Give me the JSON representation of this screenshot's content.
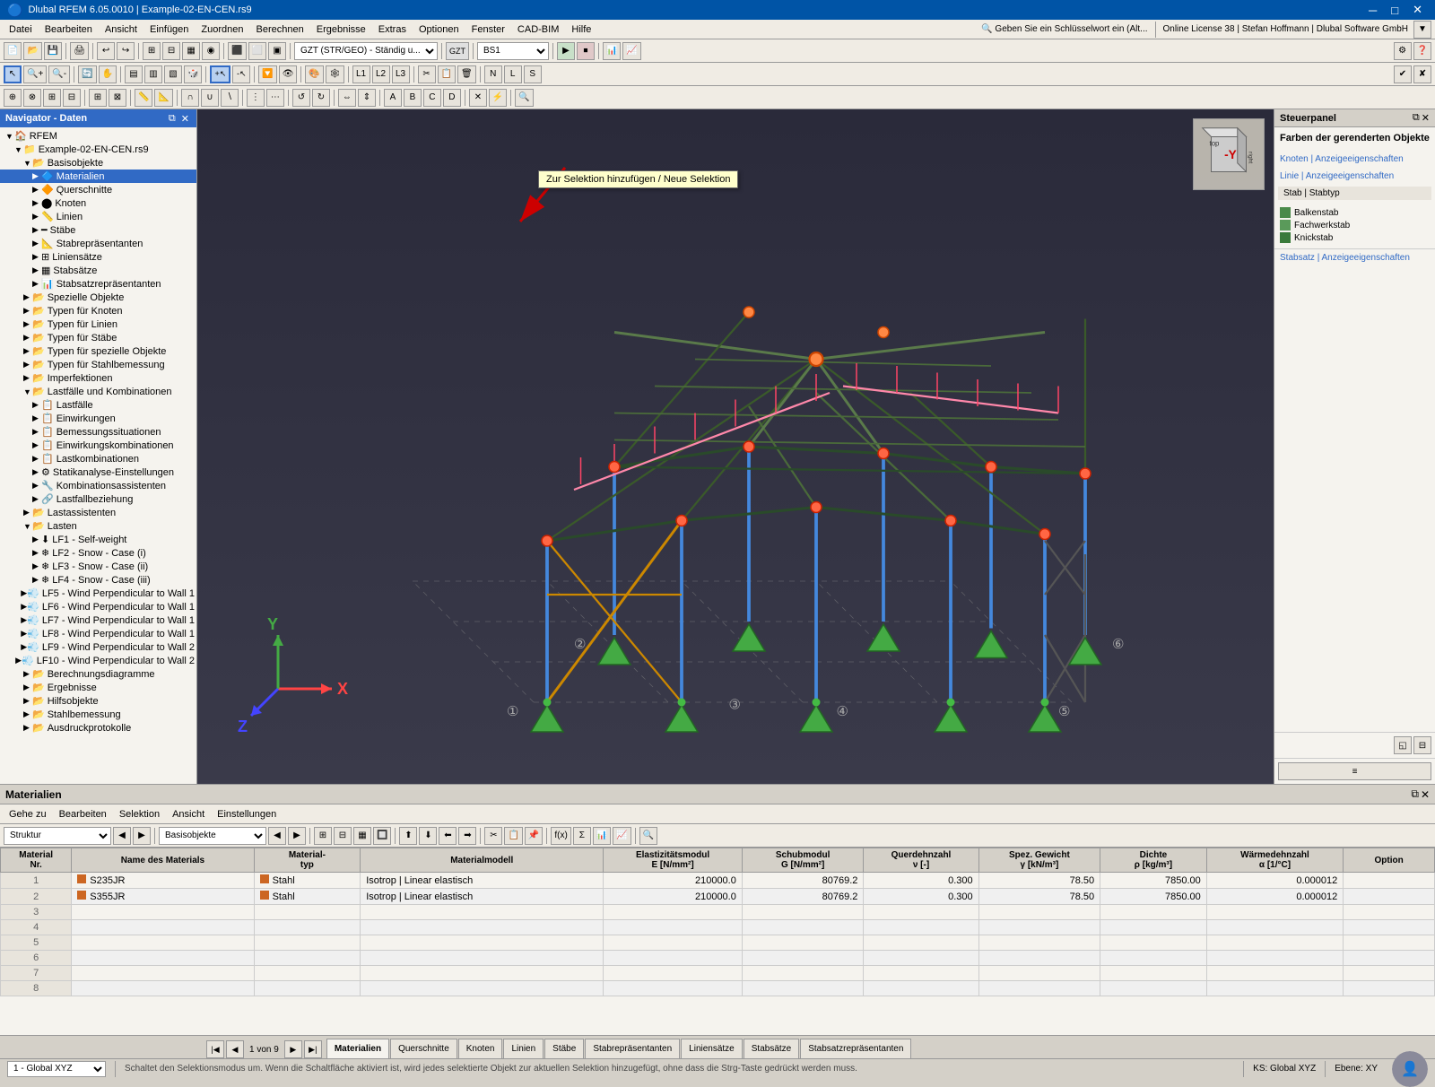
{
  "titleBar": {
    "title": "Dlubal RFEM 6.05.0010 | Example-02-EN-CEN.rs9",
    "minimizeLabel": "─",
    "maximizeLabel": "□",
    "closeLabel": "✕"
  },
  "menuBar": {
    "items": [
      "Datei",
      "Bearbeiten",
      "Ansicht",
      "Einfügen",
      "Zuordnen",
      "Berechnen",
      "Ergebnisse",
      "Extras",
      "Optionen",
      "Fenster",
      "CAD-BIM",
      "Hilfe"
    ]
  },
  "toolbar1": {
    "comboBox1": "GZT (STR/GEO) - Ständig u...",
    "comboBox2": "BS1",
    "onlineLabel": "Online License 38 | Stefan Hoffmann | Dlubal Software GmbH"
  },
  "tooltip": {
    "text": "Zur Selektion hinzufügen / Neue Selektion"
  },
  "navigator": {
    "title": "Navigator - Daten",
    "rootItem": "RFEM",
    "projectItem": "Example-02-EN-CEN.rs9",
    "tree": [
      {
        "label": "Basisobjekte",
        "level": 2,
        "expanded": true,
        "hasChildren": true
      },
      {
        "label": "Materialien",
        "level": 3,
        "expanded": false,
        "hasChildren": true
      },
      {
        "label": "Querschnitte",
        "level": 3,
        "expanded": false,
        "hasChildren": true
      },
      {
        "label": "Knoten",
        "level": 3,
        "expanded": false,
        "hasChildren": true
      },
      {
        "label": "Linien",
        "level": 3,
        "expanded": false,
        "hasChildren": true
      },
      {
        "label": "Stäbe",
        "level": 3,
        "expanded": false,
        "hasChildren": true
      },
      {
        "label": "Stabrepräsentanten",
        "level": 3,
        "expanded": false,
        "hasChildren": true
      },
      {
        "label": "Liniensätze",
        "level": 3,
        "expanded": false,
        "hasChildren": true
      },
      {
        "label": "Stabsätze",
        "level": 3,
        "expanded": false,
        "hasChildren": true
      },
      {
        "label": "Stabsatzrepräsentanten",
        "level": 3,
        "expanded": false,
        "hasChildren": true
      },
      {
        "label": "Spezielle Objekte",
        "level": 2,
        "expanded": false,
        "hasChildren": true
      },
      {
        "label": "Typen für Knoten",
        "level": 2,
        "expanded": false,
        "hasChildren": true
      },
      {
        "label": "Typen für Linien",
        "level": 2,
        "expanded": false,
        "hasChildren": true
      },
      {
        "label": "Typen für Stäbe",
        "level": 2,
        "expanded": false,
        "hasChildren": true
      },
      {
        "label": "Typen für spezielle Objekte",
        "level": 2,
        "expanded": false,
        "hasChildren": true
      },
      {
        "label": "Typen für Stahlbemessung",
        "level": 2,
        "expanded": false,
        "hasChildren": true
      },
      {
        "label": "Imperfektionen",
        "level": 2,
        "expanded": false,
        "hasChildren": true
      },
      {
        "label": "Lastfälle und Kombinationen",
        "level": 2,
        "expanded": true,
        "hasChildren": true
      },
      {
        "label": "Lastfälle",
        "level": 3,
        "expanded": false,
        "hasChildren": true
      },
      {
        "label": "Einwirkungen",
        "level": 3,
        "expanded": false,
        "hasChildren": true
      },
      {
        "label": "Bemessungssituationen",
        "level": 3,
        "expanded": false,
        "hasChildren": true
      },
      {
        "label": "Einwirkungskombinationen",
        "level": 3,
        "expanded": false,
        "hasChildren": true
      },
      {
        "label": "Lastkombinationen",
        "level": 3,
        "expanded": false,
        "hasChildren": true
      },
      {
        "label": "Statikanalyse-Einstellungen",
        "level": 3,
        "expanded": false,
        "hasChildren": true
      },
      {
        "label": "Kombinationsassistenten",
        "level": 3,
        "expanded": false,
        "hasChildren": true
      },
      {
        "label": "Lastfallbeziehung",
        "level": 3,
        "expanded": false,
        "hasChildren": true
      },
      {
        "label": "Lastassistenten",
        "level": 2,
        "expanded": false,
        "hasChildren": true
      },
      {
        "label": "Lasten",
        "level": 2,
        "expanded": true,
        "hasChildren": true
      },
      {
        "label": "LF1 - Self-weight",
        "level": 3,
        "expanded": false,
        "hasChildren": false
      },
      {
        "label": "LF2 - Snow - Case (i)",
        "level": 3,
        "expanded": false,
        "hasChildren": false
      },
      {
        "label": "LF3 - Snow - Case (ii)",
        "level": 3,
        "expanded": false,
        "hasChildren": false
      },
      {
        "label": "LF4 - Snow - Case (iii)",
        "level": 3,
        "expanded": false,
        "hasChildren": false
      },
      {
        "label": "LF5 - Wind Perpendicular to Wall 1",
        "level": 3,
        "expanded": false,
        "hasChildren": false
      },
      {
        "label": "LF6 - Wind Perpendicular to Wall 1",
        "level": 3,
        "expanded": false,
        "hasChildren": false
      },
      {
        "label": "LF7 - Wind Perpendicular to Wall 1",
        "level": 3,
        "expanded": false,
        "hasChildren": false
      },
      {
        "label": "LF8 - Wind Perpendicular to Wall 1",
        "level": 3,
        "expanded": false,
        "hasChildren": false
      },
      {
        "label": "LF9 - Wind Perpendicular to Wall 2",
        "level": 3,
        "expanded": false,
        "hasChildren": false
      },
      {
        "label": "LF10 - Wind Perpendicular to Wall 2",
        "level": 3,
        "expanded": false,
        "hasChildren": false
      },
      {
        "label": "Berechnungsdiagramme",
        "level": 2,
        "expanded": false,
        "hasChildren": true
      },
      {
        "label": "Ergebnisse",
        "level": 2,
        "expanded": false,
        "hasChildren": true
      },
      {
        "label": "Hilfsobjekte",
        "level": 2,
        "expanded": false,
        "hasChildren": true
      },
      {
        "label": "Stahlbemessung",
        "level": 2,
        "expanded": false,
        "hasChildren": true
      },
      {
        "label": "Ausdruckprotokolle",
        "level": 2,
        "expanded": false,
        "hasChildren": true
      }
    ]
  },
  "rightPanel": {
    "title": "Steuerpanel",
    "section1Title": "Farben der gerenderten Objekte",
    "knoten": "Knoten | Anzeigeeigenschaften",
    "linie": "Linie | Anzeigeeigenschaften",
    "stabStabtyp": "Stab | Stabtyp",
    "legend": [
      {
        "label": "Balkenstab",
        "color": "#4a7c4a"
      },
      {
        "label": "Fachwerkstab",
        "color": "#5a8a5a"
      },
      {
        "label": "Knickstab",
        "color": "#3a6a3a"
      }
    ],
    "stabsatz": "Stabsatz | Anzeigeeigenschaften"
  },
  "bottomPanel": {
    "title": "Materialien",
    "menuItems": [
      "Gehe zu",
      "Bearbeiten",
      "Selektion",
      "Ansicht",
      "Einstellungen"
    ],
    "dropdowns": {
      "struktur": "Struktur",
      "basisobjekte": "Basisobjekte"
    },
    "tableHeaders": [
      "Material\nNr.",
      "Name des Materials",
      "Material-\ntyp",
      "Materialmodell",
      "Elastizitätsmodul\nE [N/mm²]",
      "Schubmodul\nG [N/mm²]",
      "Querdehnzahl\nν [-]",
      "Spez. Gewicht\nγ [kN/m³]",
      "Dichte\nρ [kg/m³]",
      "Wärmedehnzahl\nα [1/°C]",
      "Option"
    ],
    "tableRows": [
      {
        "nr": 1,
        "name": "S235JR",
        "typ": "Stahl",
        "modell": "Isotrop | Linear elastisch",
        "eModul": "210000.0",
        "gModul": "80769.2",
        "quer": "0.300",
        "spez": "78.50",
        "dichte": "7850.00",
        "waerme": "0.000012",
        "option": ""
      },
      {
        "nr": 2,
        "name": "S355JR",
        "typ": "Stahl",
        "modell": "Isotrop | Linear elastisch",
        "eModul": "210000.0",
        "gModul": "80769.2",
        "quer": "0.300",
        "spez": "78.50",
        "dichte": "7850.00",
        "waerme": "0.000012",
        "option": ""
      },
      {
        "nr": 3,
        "name": "",
        "typ": "",
        "modell": "",
        "eModul": "",
        "gModul": "",
        "quer": "",
        "spez": "",
        "dichte": "",
        "waerme": "",
        "option": ""
      },
      {
        "nr": 4,
        "name": "",
        "typ": "",
        "modell": "",
        "eModul": "",
        "gModul": "",
        "quer": "",
        "spez": "",
        "dichte": "",
        "waerme": "",
        "option": ""
      },
      {
        "nr": 5,
        "name": "",
        "typ": "",
        "modell": "",
        "eModul": "",
        "gModul": "",
        "quer": "",
        "spez": "",
        "dichte": "",
        "waerme": "",
        "option": ""
      },
      {
        "nr": 6,
        "name": "",
        "typ": "",
        "modell": "",
        "eModul": "",
        "gModul": "",
        "quer": "",
        "spez": "",
        "dichte": "",
        "waerme": "",
        "option": ""
      },
      {
        "nr": 7,
        "name": "",
        "typ": "",
        "modell": "",
        "eModul": "",
        "gModul": "",
        "quer": "",
        "spez": "",
        "dichte": "",
        "waerme": "",
        "option": ""
      },
      {
        "nr": 8,
        "name": "",
        "typ": "",
        "modell": "",
        "eModul": "",
        "gModul": "",
        "quer": "",
        "spez": "",
        "dichte": "",
        "waerme": "",
        "option": ""
      }
    ]
  },
  "tabBar": {
    "tabs": [
      "Materialien",
      "Querschnitte",
      "Knoten",
      "Linien",
      "Stäbe",
      "Stabrepräsentanten",
      "Liniensätze",
      "Stabsätze",
      "Stabsatzrepräsentanten"
    ],
    "activeTab": "Materialien",
    "navInfo": "1 von 9"
  },
  "statusBar": {
    "modeLabel": "1 - Global XYZ",
    "statusText": "Schaltet den Selektionsmodus um. Wenn die Schaltfläche aktiviert ist, wird jedes selektierte Objekt zur aktuellen Selektion hinzugefügt, ohne dass die Strg-Taste gedrückt werden muss.",
    "ksLabel": "KS: Global XYZ",
    "ebeneLabel": "Ebene: XY"
  }
}
